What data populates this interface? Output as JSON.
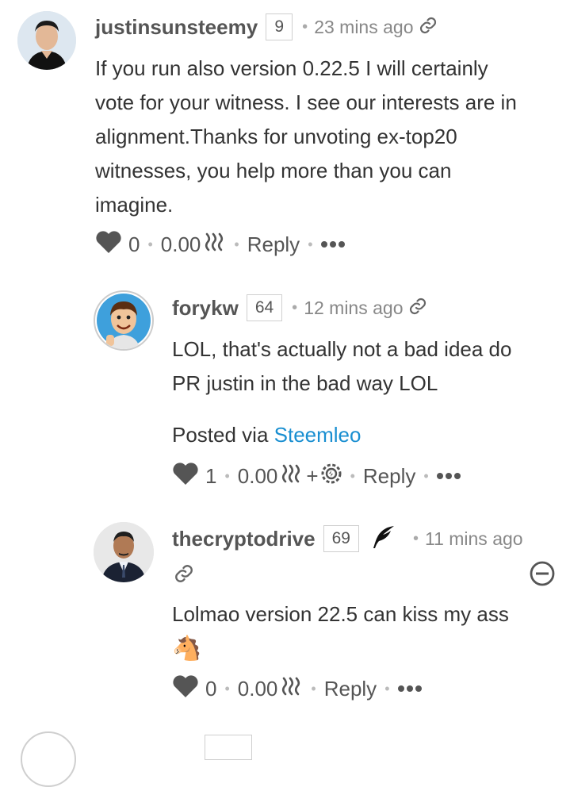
{
  "comments": [
    {
      "author": "justinsunsteemy",
      "reputation": "9",
      "time": "23 mins ago",
      "body": [
        "If you run also version 0.22.5 I will certainly",
        "vote for your witness. I see our interests are in",
        "alignment.Thanks for unvoting ex-top20",
        "witnesses, you help more than you can",
        "imagine."
      ],
      "votes": "0",
      "payout": "0.00",
      "reply_label": "Reply"
    },
    {
      "author": "forykw",
      "reputation": "64",
      "time": "12 mins ago",
      "body": [
        "LOL, that's actually not a bad idea do",
        "PR justin in the bad way LOL"
      ],
      "posted_via_label": "Posted via",
      "posted_via_link": "Steemleo",
      "votes": "1",
      "payout": "0.00",
      "plus": "+",
      "reply_label": "Reply"
    },
    {
      "author": "thecryptodrive",
      "reputation": "69",
      "time": "11 mins ago",
      "body": [
        "Lolmao version 22.5 can kiss my ass",
        "🐴"
      ],
      "votes": "0",
      "payout": "0.00",
      "reply_label": "Reply"
    }
  ],
  "colors": {
    "link": "#1a8fd1",
    "icon": "#555555",
    "muted": "#888888"
  },
  "icons": [
    "link-icon",
    "heart-icon",
    "steem-icon",
    "more-icon",
    "quill-icon",
    "collapse-icon",
    "settings-icon"
  ]
}
